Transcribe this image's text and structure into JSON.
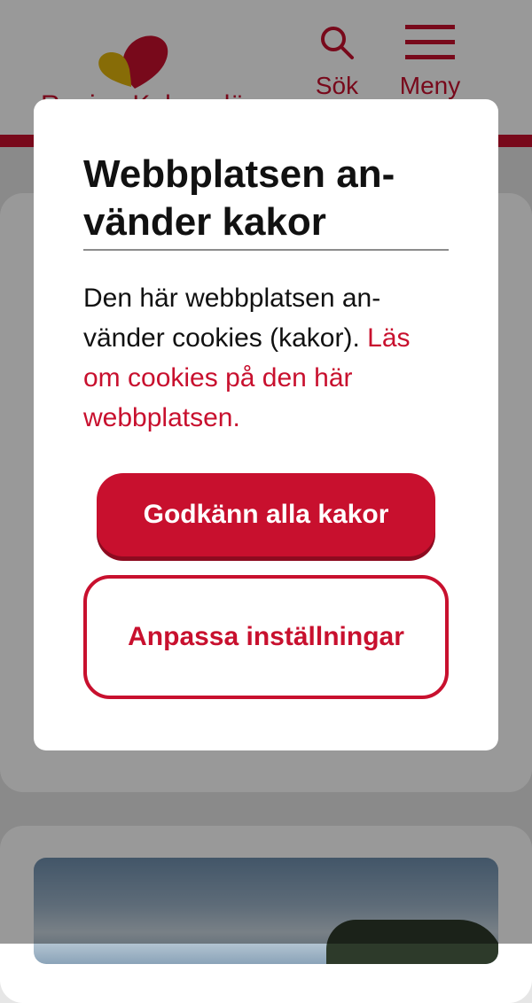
{
  "header": {
    "logo_text": "Region Kalmar län",
    "search_label": "Sök",
    "menu_label": "Meny"
  },
  "colors": {
    "brand_red": "#c8102e",
    "logo_yellow": "#e2b40c"
  },
  "icons": {
    "search": "search-icon",
    "menu": "hamburger-menu-icon",
    "logo": "heart-logo-icon"
  },
  "cookie_dialog": {
    "title": "Webbplatsen an­vänder kakor",
    "body_text": "Den här webbplatsen an­vänder cookies (kakor). ",
    "body_link": "Läs om cookies på den här webbplatsen.",
    "accept_label": "Godkänn alla kakor",
    "customize_label": "Anpassa inställningar"
  }
}
